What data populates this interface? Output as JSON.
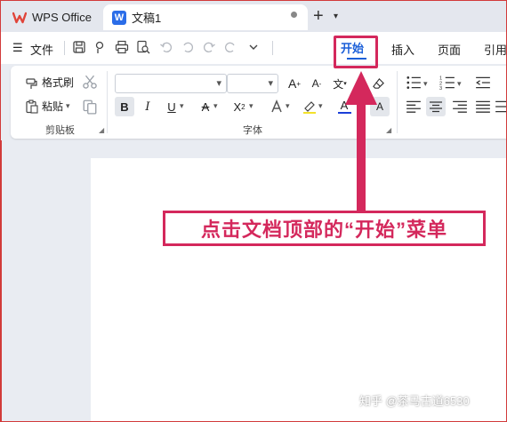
{
  "titlebar": {
    "app_tab": "WPS Office",
    "doc_tab": "文稿1",
    "doc_logo_letter": "W"
  },
  "menubar": {
    "file": "文件",
    "tabs": [
      "开始",
      "插入",
      "页面",
      "引用"
    ]
  },
  "ribbon": {
    "clipboard": {
      "format_painter": "格式刷",
      "paste": "粘贴",
      "group_label": "剪贴板"
    },
    "font": {
      "group_label": "字体",
      "font_name": "",
      "font_size": ""
    }
  },
  "annotation": {
    "text": "点击文档顶部的“开始”菜单"
  },
  "watermark": "知乎 @茶马古道6530",
  "colors": {
    "accent": "#1b5fd8",
    "annotation": "#d4285c",
    "wps_red": "#e0453a"
  }
}
